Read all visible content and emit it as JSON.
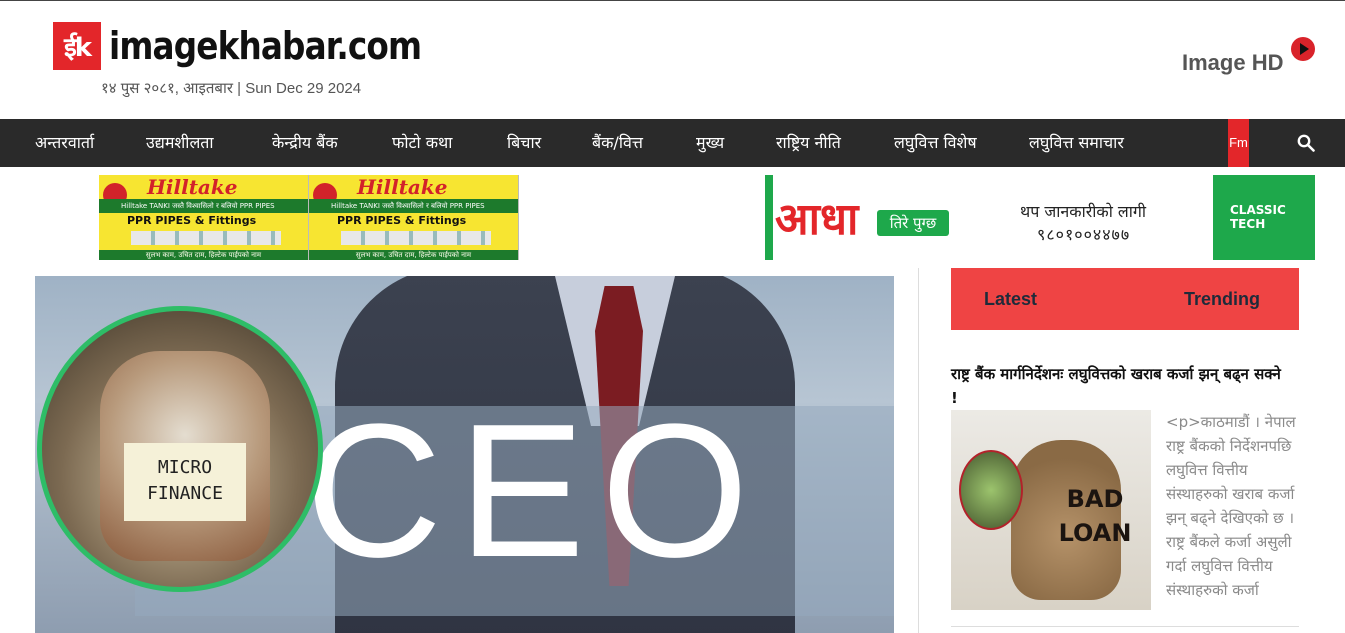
{
  "site": {
    "logo_mark": "ईk",
    "logo_text": "imagekhabar.com",
    "date": "१४ पुस २०८१, आइतबार | Sun Dec 29 2024",
    "image_hd_label": "Image HD"
  },
  "nav": {
    "items": [
      {
        "label": "अन्तरवार्ता"
      },
      {
        "label": "उद्यमशीलता"
      },
      {
        "label": "केन्द्रीय बैंक"
      },
      {
        "label": "फोटो कथा"
      },
      {
        "label": "बिचार"
      },
      {
        "label": "बैंक/वित्त"
      },
      {
        "label": "मुख्य"
      },
      {
        "label": "राष्ट्रिय नीति"
      },
      {
        "label": "लघुवित्त विशेष"
      },
      {
        "label": "लघुवित्त समाचार"
      }
    ],
    "fm_label": "Fm"
  },
  "ads": {
    "hilltake": {
      "brand": "Hilltake",
      "tagline": "Hilltake TANKI जस्तै विश्वासिलो र बलियो PPR PIPES",
      "product": "PPR PIPES & Fittings",
      "bottom": "सुलभ काम, उचित दाम, हिल्टेक पाईपको नाम"
    },
    "classic_tech": {
      "headline": "आधा",
      "badge": "तिरे पुग्छ",
      "info": "थप जानकारीको लागी",
      "phone": "९८०१००४४७७",
      "brand": "CLASSIC TECH"
    }
  },
  "feature": {
    "image_text": "CEO",
    "badge_text": "MICRO FINANCE"
  },
  "sidebar": {
    "tabs": [
      {
        "label": "Latest"
      },
      {
        "label": "Trending"
      }
    ],
    "article": {
      "title": "राष्ट्र बैंक मार्गनिर्देशनः लघुवित्तको खराब कर्जा झन् बढ्न सक्ने !",
      "thumb_text": "BAD LOAN",
      "excerpt": "<p>काठमाडौं । नेपाल राष्ट्र बैंकको निर्देशनपछि लघुवित्त वित्तीय संस्थाहरुको खराब कर्जा झन् बढ्ने देखिएको छ । राष्ट्र बैंकले कर्जा असुली गर्दा लघुवित्त वित्तीय संस्थाहरुको कर्जा"
    }
  },
  "colors": {
    "brand_red": "#e3262a",
    "nav_bg": "#2a2a2a",
    "tabs_bg": "#ef4444",
    "feature_border": "#2ebd67"
  }
}
